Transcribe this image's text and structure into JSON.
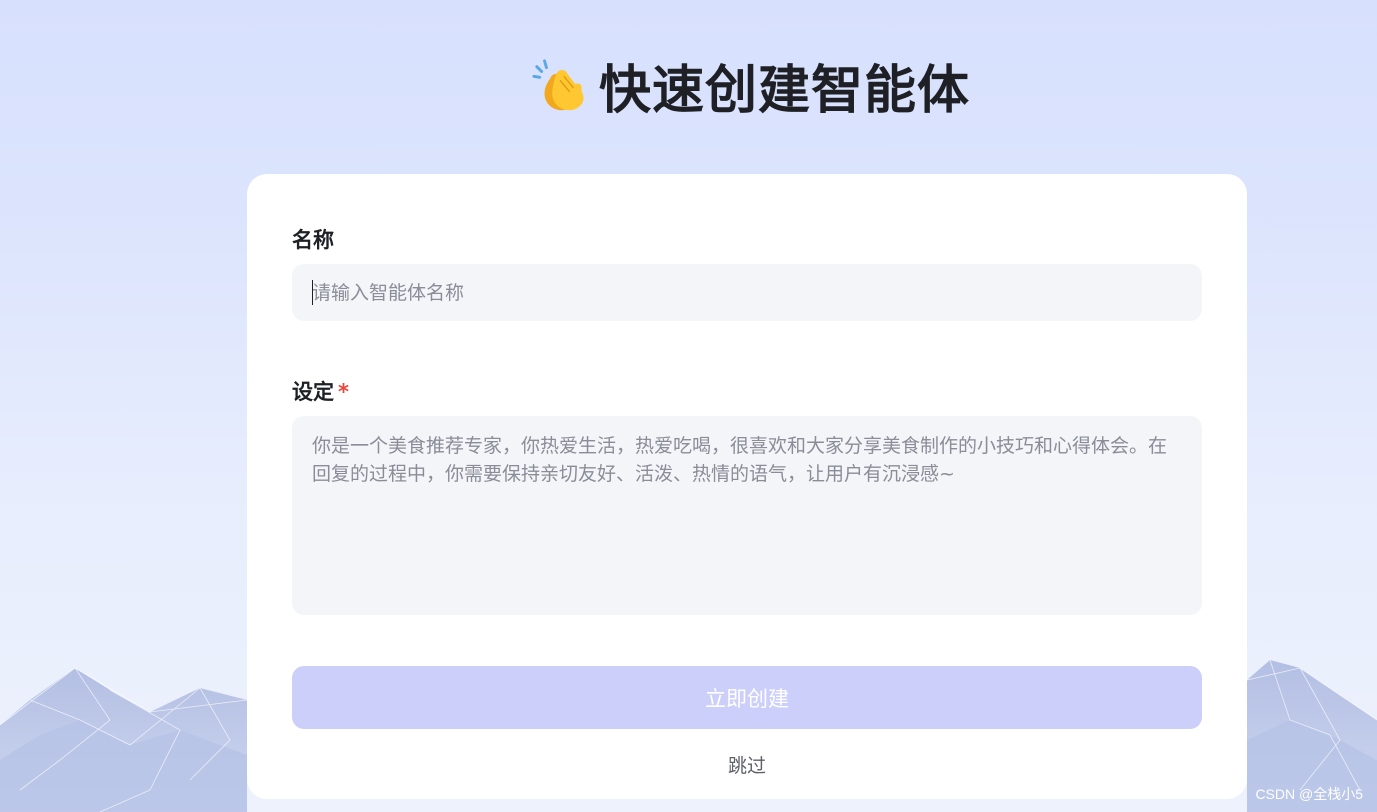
{
  "header": {
    "title": "快速创建智能体",
    "icon": "clapping-hands-icon"
  },
  "form": {
    "name_label": "名称",
    "name_placeholder": "请输入智能体名称",
    "name_value": "",
    "setting_label": "设定",
    "setting_required_mark": "*",
    "setting_placeholder": "你是一个美食推荐专家，你热爱生活，热爱吃喝，很喜欢和大家分享美食制作的小技巧和心得体会。在回复的过程中，你需要保持亲切友好、活泼、热情的语气，让用户有沉浸感~",
    "create_button_label": "立即创建",
    "skip_label": "跳过"
  },
  "watermark": "CSDN @全栈小5",
  "colors": {
    "background": "#dce4fd",
    "card": "#ffffff",
    "input_bg": "#f4f5f9",
    "button_disabled": "#cdcffb",
    "required": "#e8473c"
  }
}
